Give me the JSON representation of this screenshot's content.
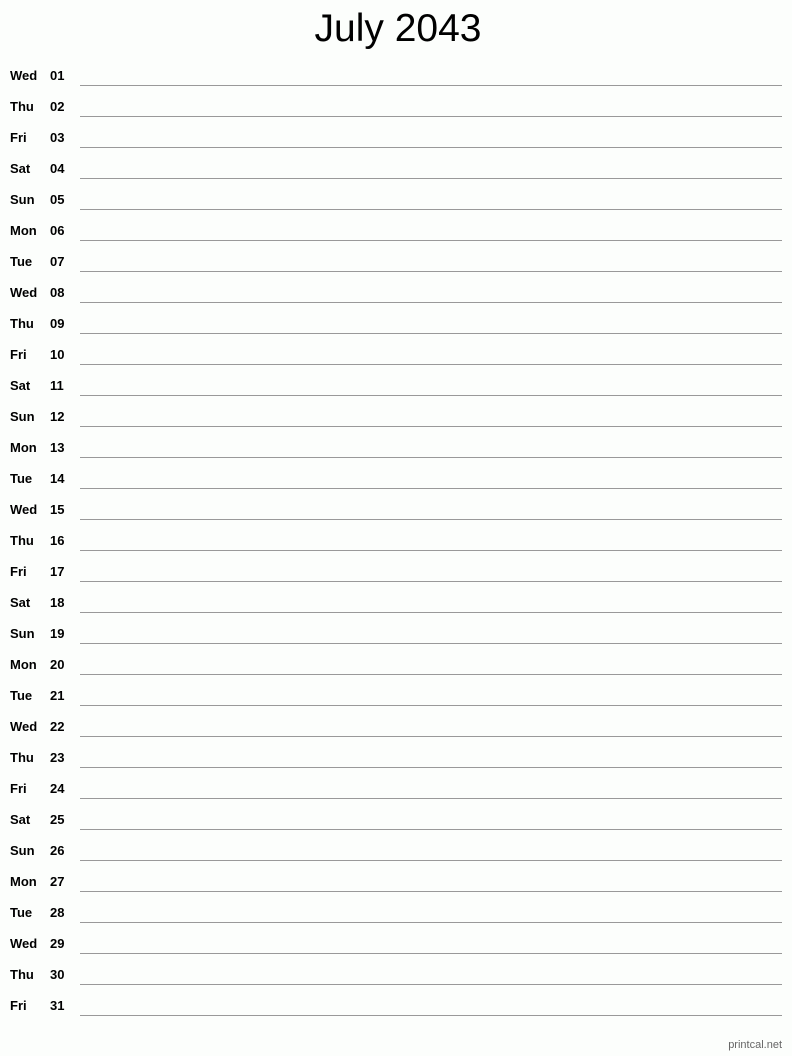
{
  "title": "July 2043",
  "days": [
    {
      "dow": "Wed",
      "num": "01"
    },
    {
      "dow": "Thu",
      "num": "02"
    },
    {
      "dow": "Fri",
      "num": "03"
    },
    {
      "dow": "Sat",
      "num": "04"
    },
    {
      "dow": "Sun",
      "num": "05"
    },
    {
      "dow": "Mon",
      "num": "06"
    },
    {
      "dow": "Tue",
      "num": "07"
    },
    {
      "dow": "Wed",
      "num": "08"
    },
    {
      "dow": "Thu",
      "num": "09"
    },
    {
      "dow": "Fri",
      "num": "10"
    },
    {
      "dow": "Sat",
      "num": "11"
    },
    {
      "dow": "Sun",
      "num": "12"
    },
    {
      "dow": "Mon",
      "num": "13"
    },
    {
      "dow": "Tue",
      "num": "14"
    },
    {
      "dow": "Wed",
      "num": "15"
    },
    {
      "dow": "Thu",
      "num": "16"
    },
    {
      "dow": "Fri",
      "num": "17"
    },
    {
      "dow": "Sat",
      "num": "18"
    },
    {
      "dow": "Sun",
      "num": "19"
    },
    {
      "dow": "Mon",
      "num": "20"
    },
    {
      "dow": "Tue",
      "num": "21"
    },
    {
      "dow": "Wed",
      "num": "22"
    },
    {
      "dow": "Thu",
      "num": "23"
    },
    {
      "dow": "Fri",
      "num": "24"
    },
    {
      "dow": "Sat",
      "num": "25"
    },
    {
      "dow": "Sun",
      "num": "26"
    },
    {
      "dow": "Mon",
      "num": "27"
    },
    {
      "dow": "Tue",
      "num": "28"
    },
    {
      "dow": "Wed",
      "num": "29"
    },
    {
      "dow": "Thu",
      "num": "30"
    },
    {
      "dow": "Fri",
      "num": "31"
    }
  ],
  "footer": "printcal.net"
}
